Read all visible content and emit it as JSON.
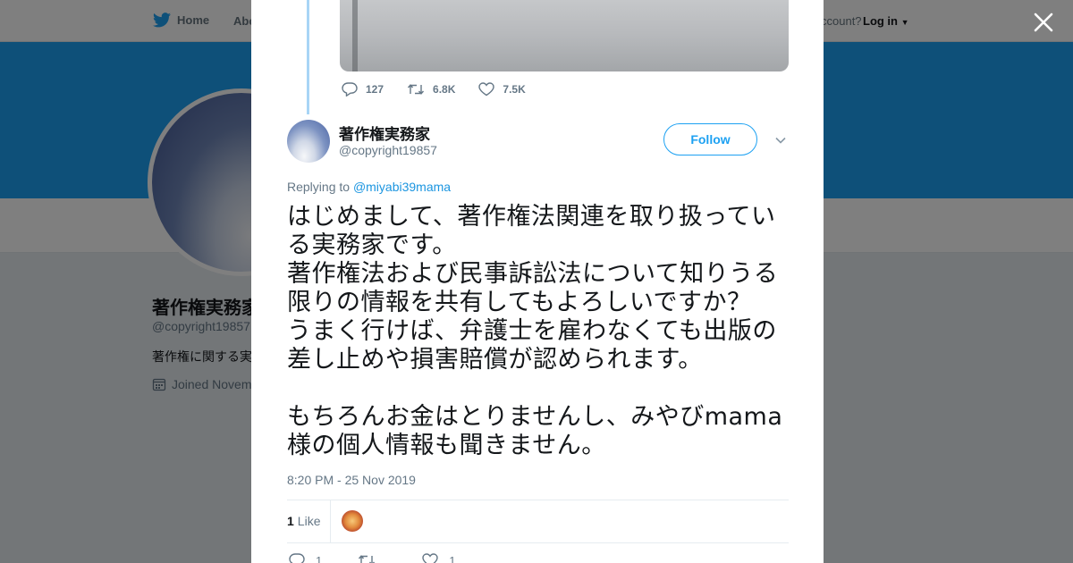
{
  "background": {
    "nav": {
      "home": "Home",
      "about": "Abo",
      "account_prompt": "ccount?",
      "login": "Log in"
    },
    "profile": {
      "name": "著作権実務家",
      "handle": "@copyright19857",
      "bio": "著作権に関する実",
      "joined": "Joined Novem"
    },
    "colors": {
      "brand": "#1da1f2",
      "overlay": "rgba(0,0,0,0.5)"
    }
  },
  "previous_tweet": {
    "replies": "127",
    "retweets": "6.8K",
    "likes": "7.5K"
  },
  "tweet": {
    "author_name": "著作権実務家",
    "author_handle": "@copyright19857",
    "follow_label": "Follow",
    "replying_prefix": "Replying to",
    "replying_to": "@miyabi39mama",
    "text": "はじめまして、著作権法関連を取り扱ってい\nる実務家です。\n著作権法および民事訴訟法について知りうる\n限りの情報を共有してもよろしいですか？\nうまく行けば、弁護士を雇わなくても出版の\n差し止めや損害賠償が認められます。\n\nもちろんお金はとりませんし、みやびmama\n様の個人情報も聞きません。",
    "timestamp": "8:20 PM - 25 Nov 2019",
    "like_count": "1",
    "like_label": "Like",
    "actions": {
      "replies": "1",
      "retweets": "",
      "likes": "1"
    }
  },
  "icons": [
    "twitter-bird-icon",
    "close-icon",
    "reply-icon",
    "retweet-icon",
    "heart-icon",
    "chevron-down-icon",
    "calendar-icon"
  ]
}
